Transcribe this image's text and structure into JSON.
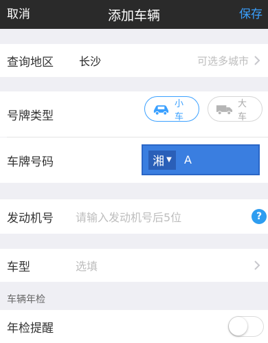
{
  "nav": {
    "cancel_label": "取消",
    "title": "添加车辆",
    "save_label": "保存"
  },
  "region": {
    "label": "查询地区",
    "value": "长沙",
    "hint": "可选多城市"
  },
  "plate_type": {
    "label": "号牌类型",
    "options": [
      {
        "label": "小车",
        "selected": true
      },
      {
        "label": "大车",
        "selected": false
      }
    ]
  },
  "plate_number": {
    "label": "车牌号码",
    "province": "湘",
    "value": "A"
  },
  "engine": {
    "label": "发动机号",
    "placeholder": "请输入发动机号后5位"
  },
  "model": {
    "label": "车型",
    "placeholder": "选填"
  },
  "inspection": {
    "section_title": "车辆年检",
    "reminder_label": "年检提醒",
    "reminder_on": false
  },
  "colors": {
    "accent": "#3aa0ff",
    "navbar": "#2a2a2a",
    "plate_bg": "#3a7ee0"
  }
}
